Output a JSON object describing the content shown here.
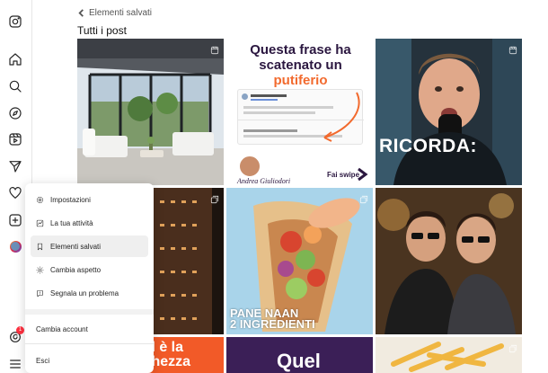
{
  "header": {
    "back_label": "Elementi salvati",
    "title": "Tutti i post"
  },
  "rail": {
    "icons": [
      "instagram-icon",
      "home-icon",
      "search-icon",
      "explore-icon",
      "reels-icon",
      "messages-icon",
      "notifications-icon",
      "create-icon",
      "profile-avatar"
    ],
    "threads_badge": "1"
  },
  "menu": {
    "items": [
      {
        "label": "Impostazioni",
        "icon": "gear-icon"
      },
      {
        "label": "La tua attività",
        "icon": "activity-icon"
      },
      {
        "label": "Elementi salvati",
        "icon": "bookmark-icon"
      },
      {
        "label": "Cambia aspetto",
        "icon": "sun-icon"
      },
      {
        "label": "Segnala un problema",
        "icon": "report-icon"
      }
    ],
    "switch_account": "Cambia account",
    "logout": "Esci"
  },
  "posts": {
    "p2": {
      "headline": "Questa frase ha scatenato un",
      "headline_accent": "putiferio",
      "author": "Andrea Giuliodori",
      "cta": "Fai swipe"
    },
    "p3": {
      "caption": "RICORDA:"
    },
    "p5": {
      "caption_line1": "PANE NAAN",
      "caption_line2": "2 INGREDIENTI"
    },
    "p7": {
      "caption_line1": "qual è la",
      "caption_line2": "ricchezza"
    },
    "p8": {
      "caption": "Quel"
    }
  },
  "colors": {
    "accent": "#e1306c",
    "orange": "#f26a2e",
    "purple": "#3b1f57"
  }
}
